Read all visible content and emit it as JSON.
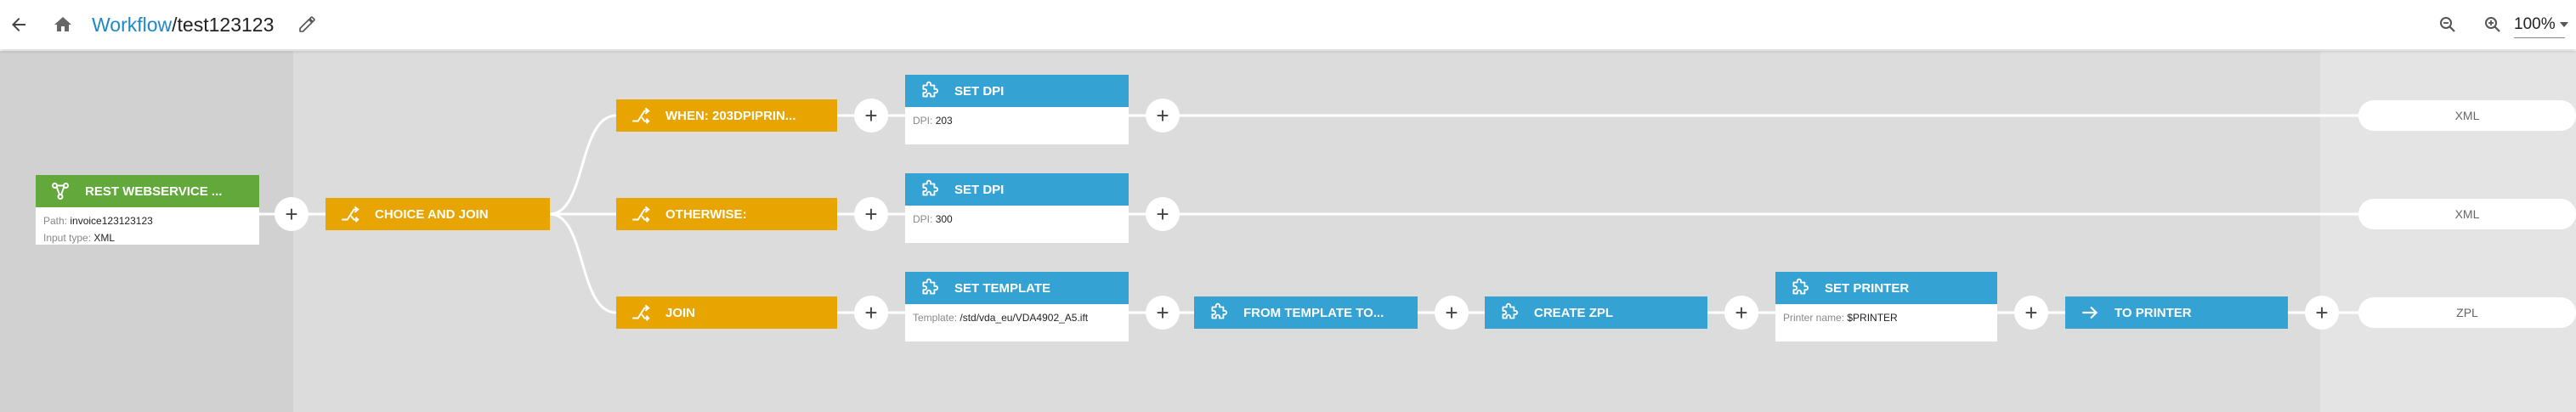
{
  "header": {
    "breadcrumb_root": "Workflow",
    "breadcrumb_sep": "/",
    "workflow_name": "test123123",
    "zoom_level": "100%"
  },
  "icons": {
    "back": "arrow-left-icon",
    "home": "home-icon",
    "edit": "pencil-icon",
    "zoom_out": "zoom-out-icon",
    "zoom_in": "zoom-in-icon"
  },
  "colors": {
    "source": "#62a83a",
    "router": "#e8a400",
    "processor": "#35a2d4",
    "link": "#1e88c7"
  },
  "nodes": {
    "rest": {
      "title": "REST WEBSERVICE ...",
      "path_label": "Path:",
      "path_value": "invoice123123123",
      "input_label": "Input type:",
      "input_value": "XML"
    },
    "choice": {
      "title": "CHOICE AND JOIN"
    },
    "when": {
      "title": "WHEN: 203DPIPRIN..."
    },
    "otherwise": {
      "title": "OTHERWISE:"
    },
    "join": {
      "title": "JOIN"
    },
    "setdpi1": {
      "title": "SET DPI",
      "label": "DPI:",
      "value": "203"
    },
    "setdpi2": {
      "title": "SET DPI",
      "label": "DPI:",
      "value": "300"
    },
    "settemplate": {
      "title": "SET TEMPLATE",
      "label": "Template:",
      "value": "/std/vda_eu/VDA4902_A5.ift"
    },
    "fromtemplate": {
      "title": "FROM TEMPLATE TO..."
    },
    "createzpl": {
      "title": "CREATE ZPL"
    },
    "setprinter": {
      "title": "SET PRINTER",
      "label": "Printer name:",
      "value": "$PRINTER"
    },
    "toprinter": {
      "title": "TO PRINTER"
    }
  },
  "outputs": {
    "o1": "XML",
    "o2": "XML",
    "o3": "ZPL"
  }
}
